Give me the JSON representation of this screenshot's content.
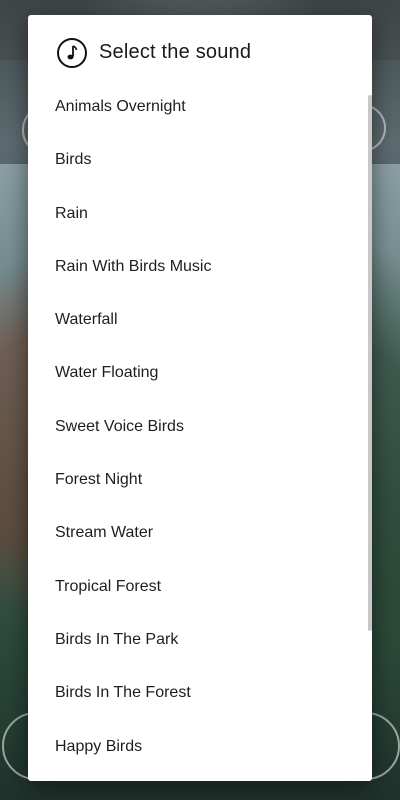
{
  "dialog": {
    "title": "Select the sound",
    "title_icon": "music-note-icon"
  },
  "sounds": [
    "Animals Overnight",
    "Birds",
    "Rain",
    "Rain With Birds Music",
    "Waterfall",
    "Water Floating",
    "Sweet Voice Birds",
    "Forest Night",
    "Stream Water",
    "Tropical Forest",
    "Birds In The Park",
    "Birds In The Forest",
    "Happy Birds"
  ],
  "colors": {
    "dialog_bg": "#ffffff",
    "text": "#1e1e1e",
    "scrollbar": "#c8c8c8",
    "scrim_top": "#5d6a6c"
  }
}
